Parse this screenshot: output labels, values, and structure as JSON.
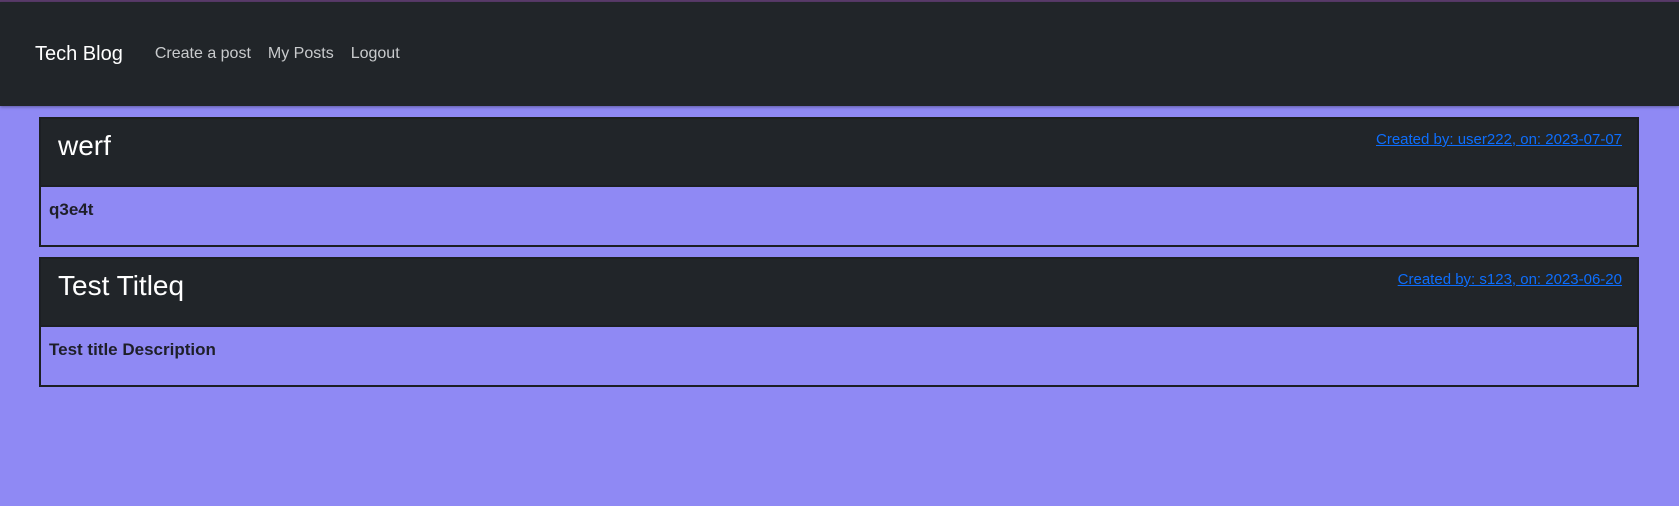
{
  "navbar": {
    "brand": "Tech Blog",
    "links": [
      {
        "label": "Create a post"
      },
      {
        "label": "My Posts"
      },
      {
        "label": "Logout"
      }
    ]
  },
  "posts": [
    {
      "title": "werf",
      "meta": "Created by: user222, on: 2023-07-07",
      "description": "q3e4t"
    },
    {
      "title": "Test Titleq",
      "meta": "Created by: s123, on: 2023-06-20",
      "description": "Test title Description"
    }
  ],
  "colors": {
    "page_background": "#8f89f4",
    "navbar_background": "#212529",
    "link_blue": "#0d6efd"
  }
}
